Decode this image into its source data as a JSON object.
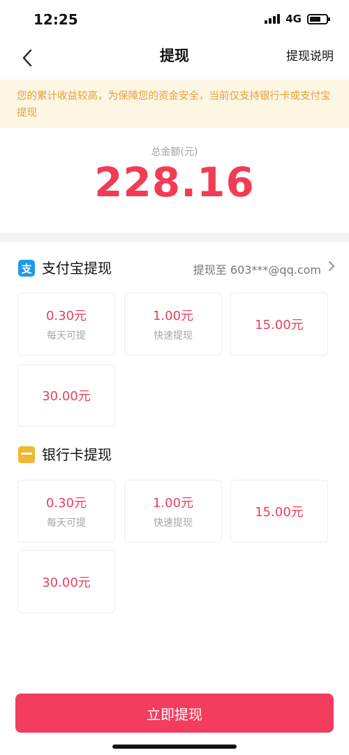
{
  "status": {
    "time": "12:25",
    "network": "4G"
  },
  "nav": {
    "title": "提现",
    "right_label": "提现说明"
  },
  "notice": "您的累计收益较高，为保障您的资金安全，当前仅支持银行卡或支付宝提现",
  "balance": {
    "label": "总金额(元)",
    "amount": "228.16"
  },
  "alipay": {
    "title": "支付宝提现",
    "destination": "提现至 603***@qq.com",
    "options": [
      {
        "amount": "0.30元",
        "sub": "每天可提"
      },
      {
        "amount": "1.00元",
        "sub": "快速提现"
      },
      {
        "amount": "15.00元"
      },
      {
        "amount": "30.00元"
      }
    ]
  },
  "bank": {
    "title": "银行卡提现",
    "options": [
      {
        "amount": "0.30元",
        "sub": "每天可提"
      },
      {
        "amount": "1.00元",
        "sub": "快速提现"
      },
      {
        "amount": "15.00元"
      },
      {
        "amount": "30.00元"
      }
    ]
  },
  "submit_label": "立即提现",
  "colors": {
    "accent": "#f33b55",
    "button": "#f43d5e",
    "notice_bg": "#fdf6e3",
    "notice_text": "#e2a33a",
    "alipay_blue": "#1c9bea",
    "card_gold": "#f2b630"
  },
  "icons": {
    "back": "chevron-left-icon",
    "alipay": "alipay-icon",
    "bank": "bank-card-icon",
    "more": "chevron-right-icon"
  }
}
